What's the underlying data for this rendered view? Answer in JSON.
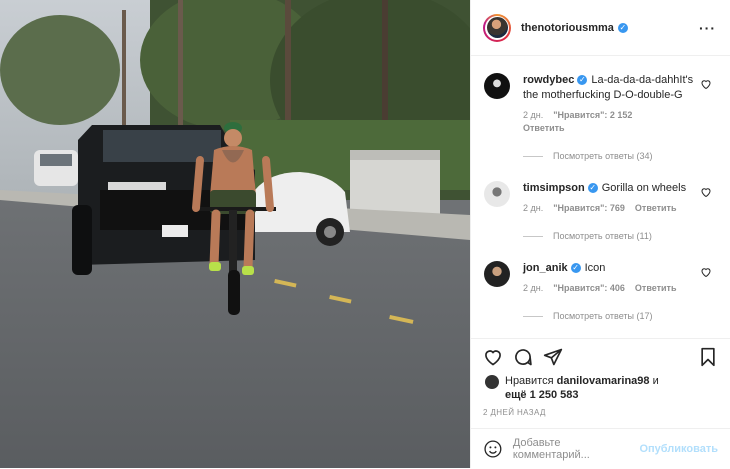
{
  "post": {
    "username": "thenotoriousmma",
    "verified_icon": "verified-badge-icon",
    "more_icon": "more-options-icon"
  },
  "comments": [
    {
      "username": "rowdybec",
      "text": "La-da-da-da-dahhIt's the motherfucking D-O-double-G",
      "time": "2 дн.",
      "likes": "\"Нравится\": 2 152",
      "reply": "Ответить",
      "view_replies": "Посмотреть ответы (34)"
    },
    {
      "username": "timsimpson",
      "text": "Gorilla on wheels",
      "time": "2 дн.",
      "likes": "\"Нравится\": 769",
      "reply": "Ответить",
      "view_replies": "Посмотреть ответы (11)"
    },
    {
      "username": "jon_anik",
      "text": "Icon",
      "time": "2 дн.",
      "likes": "\"Нравится\": 406",
      "reply": "Ответить",
      "view_replies": "Посмотреть ответы (17)"
    }
  ],
  "likes_block": {
    "prefix": "Нравится",
    "user": "danilovamarina98",
    "and": "и",
    "more": "ещё 1 250 583"
  },
  "date": "2 ДНЕЙ НАЗАД",
  "add_comment": {
    "placeholder": "Добавьте комментарий...",
    "publish": "Опубликовать"
  },
  "colors": {
    "accent": "#3897f0",
    "publish_disabled": "#b2dffc"
  }
}
